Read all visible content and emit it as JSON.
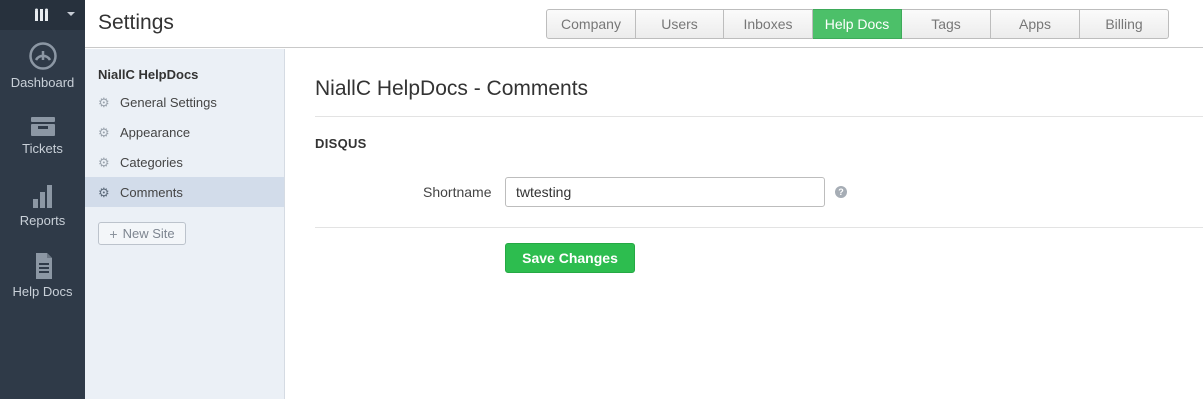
{
  "leftnav": {
    "logo_icon": "logo-icon",
    "items": [
      {
        "label": "Dashboard",
        "icon": "dashboard-icon"
      },
      {
        "label": "Tickets",
        "icon": "tickets-icon"
      },
      {
        "label": "Reports",
        "icon": "reports-icon"
      },
      {
        "label": "Help Docs",
        "icon": "helpdocs-icon"
      }
    ]
  },
  "header": {
    "title": "Settings",
    "tabs": [
      {
        "label": "Company"
      },
      {
        "label": "Users"
      },
      {
        "label": "Inboxes"
      },
      {
        "label": "Help Docs",
        "active": true
      },
      {
        "label": "Tags"
      },
      {
        "label": "Apps"
      },
      {
        "label": "Billing"
      }
    ]
  },
  "sidebar": {
    "site_name": "NiallC HelpDocs",
    "items": [
      {
        "label": "General Settings",
        "icon": "gear-icon"
      },
      {
        "label": "Appearance",
        "icon": "gear-icon"
      },
      {
        "label": "Categories",
        "icon": "gear-icon"
      },
      {
        "label": "Comments",
        "icon": "gear-icon",
        "active": true
      }
    ],
    "new_site_label": "New Site"
  },
  "main": {
    "title": "NiallC HelpDocs - Comments",
    "section_title": "DISQUS",
    "shortname_label": "Shortname",
    "shortname_value": "twtesting",
    "help_icon": "help-icon",
    "save_label": "Save Changes"
  },
  "colors": {
    "nav_bg": "#2f3a48",
    "active_tab": "#4cc069",
    "save_button": "#2dbd4f",
    "sidebar_bg": "#ebf0f6"
  }
}
